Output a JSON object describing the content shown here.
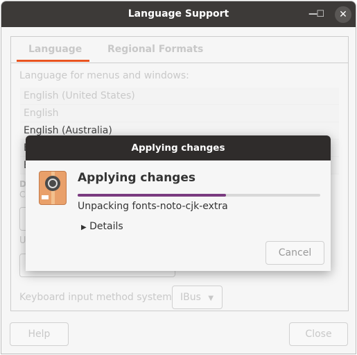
{
  "window": {
    "title": "Language Support",
    "minimize": "—",
    "maximize": "☐",
    "close": "✕"
  },
  "tabs": [
    {
      "label": "Language",
      "active": true
    },
    {
      "label": "Regional Formats",
      "active": false
    }
  ],
  "language_label": "Language for menus and windows:",
  "languages": [
    "English (United States)",
    "English",
    "English (Australia)",
    "E",
    "E"
  ],
  "obscured": {
    "drag_hint": "Dr",
    "change_hint": "Ch",
    "use_hint": "Us"
  },
  "keyboard": {
    "label": "Keyboard input method system:",
    "value": "IBus"
  },
  "buttons": {
    "help": "Help",
    "close": "Close"
  },
  "dialog": {
    "title": "Applying changes",
    "heading": "Applying changes",
    "progress_percent": 61,
    "status": "Unpacking fonts-noto-cjk-extra",
    "details": "Details",
    "cancel": "Cancel",
    "accent": "#7a3b80"
  },
  "accent": "#e95420"
}
